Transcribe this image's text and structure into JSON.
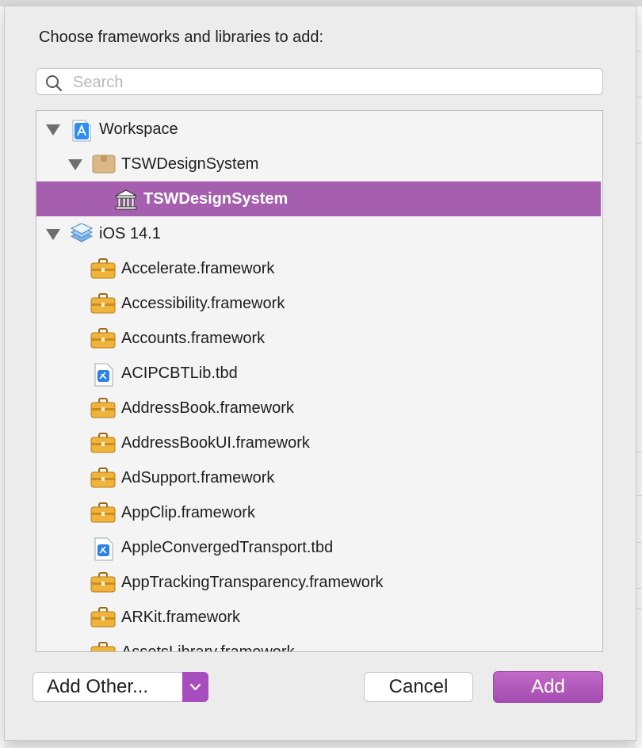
{
  "dialog": {
    "prompt": "Choose frameworks and libraries to add:",
    "search": {
      "placeholder": "Search",
      "value": ""
    },
    "rows": [
      {
        "label": "Workspace",
        "icon": "workspace-app-icon",
        "expanded": true
      },
      {
        "label": "TSWDesignSystem",
        "icon": "package-box-icon",
        "expanded": true
      },
      {
        "label": "TSWDesignSystem",
        "icon": "library-columns-icon",
        "selected": true
      },
      {
        "label": "iOS 14.1",
        "icon": "sdk-stack-icon",
        "expanded": true
      },
      {
        "label": "Accelerate.framework",
        "icon": "toolbox-icon"
      },
      {
        "label": "Accessibility.framework",
        "icon": "toolbox-icon"
      },
      {
        "label": "Accounts.framework",
        "icon": "toolbox-icon"
      },
      {
        "label": "ACIPCBTLib.tbd",
        "icon": "tbd-file-icon"
      },
      {
        "label": "AddressBook.framework",
        "icon": "toolbox-icon"
      },
      {
        "label": "AddressBookUI.framework",
        "icon": "toolbox-icon"
      },
      {
        "label": "AdSupport.framework",
        "icon": "toolbox-icon"
      },
      {
        "label": "AppClip.framework",
        "icon": "toolbox-icon"
      },
      {
        "label": "AppleConvergedTransport.tbd",
        "icon": "tbd-file-icon"
      },
      {
        "label": "AppTrackingTransparency.framework",
        "icon": "toolbox-icon"
      },
      {
        "label": "ARKit.framework",
        "icon": "toolbox-icon"
      },
      {
        "label": "AssetsLibrary.framework",
        "icon": "toolbox-icon"
      }
    ],
    "buttons": {
      "add_other": "Add Other...",
      "cancel": "Cancel",
      "add": "Add"
    },
    "colors": {
      "accent": "#a65fae",
      "button_accent": "#b55cbb"
    }
  }
}
